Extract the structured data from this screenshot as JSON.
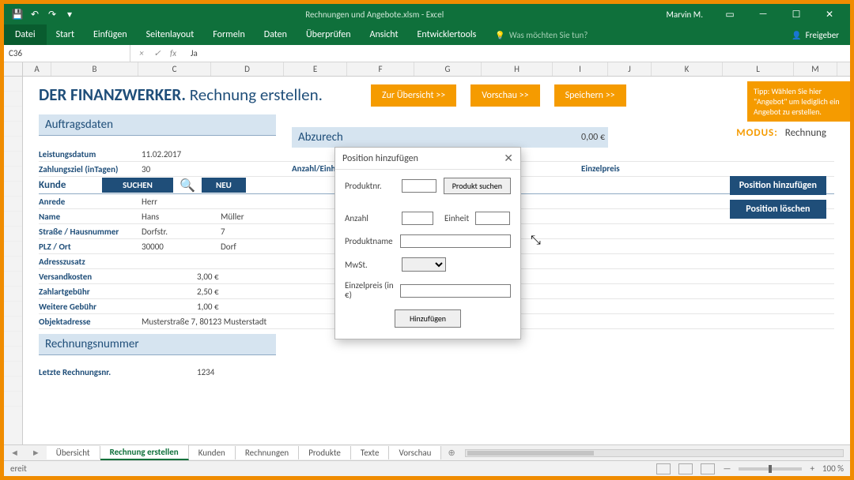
{
  "titlebar": {
    "filename": "Rechnungen und Angebote.xlsm  -  Excel",
    "username": "Marvin M."
  },
  "ribbon": {
    "file": "Datei",
    "tabs": [
      "Start",
      "Einfügen",
      "Seitenlayout",
      "Formeln",
      "Daten",
      "Überprüfen",
      "Ansicht",
      "Entwicklertools"
    ],
    "tellme": "Was möchten Sie tun?",
    "share": "Freigeber"
  },
  "formula": {
    "namebox": "C36",
    "value": "Ja"
  },
  "columns": [
    "A",
    "B",
    "C",
    "D",
    "E",
    "F",
    "G",
    "H",
    "I",
    "J",
    "K",
    "L",
    "M"
  ],
  "page": {
    "title_brand": "DER FINANZWERKER.",
    "title_sub": "Rechnung erstellen.",
    "btn_overview": "Zur Übersicht >>",
    "btn_preview": "Vorschau >>",
    "btn_save": "Speichern >>",
    "hint": "Tipp: Wählen Sie hier \"Angebot\" um lediglich ein Angebot zu erstellen.",
    "modus_label": "MODUS:",
    "modus_value": "Rechnung"
  },
  "sections": {
    "auftragsdaten": "Auftragsdaten",
    "abzurechnen": "Abzurech",
    "rechnungsnr": "Rechnungsnummer"
  },
  "fields": {
    "leistungsdatum_l": "Leistungsdatum",
    "leistungsdatum_v": "11.02.2017",
    "zahlungsziel_l": "Zahlungsziel (inTagen)",
    "zahlungsziel_v": "30",
    "kunde_l": "Kunde",
    "suchen": "SUCHEN",
    "neu": "NEU",
    "anrede_l": "Anrede",
    "anrede_v": "Herr",
    "name_l": "Name",
    "name_v1": "Hans",
    "name_v2": "Müller",
    "strasse_l": "Straße / Hausnummer",
    "strasse_v1": "Dorfstr.",
    "strasse_v2": "7",
    "plz_l": "PLZ / Ort",
    "plz_v1": "30000",
    "plz_v2": "Dorf",
    "adresszusatz_l": "Adresszusatz",
    "versand_l": "Versandkosten",
    "versand_v": "3,00 €",
    "zahlart_l": "Zahlartgebühr",
    "zahlart_v": "2,50 €",
    "weitere_l": "Weitere Gebühr",
    "weitere_v": "1,00 €",
    "objekt_l": "Objektadresse",
    "objekt_v": "Musterstraße 7, 80123 Musterstadt",
    "letzte_l": "Letzte Rechnungsnr.",
    "letzte_v": "1234"
  },
  "billing": {
    "col_anzahl": "Anzahl/Einhe",
    "col_einzelpreis": "Einzelpreis",
    "total": "0,00 €",
    "btn_add": "Position hinzufügen",
    "btn_del": "Position löschen"
  },
  "dialog": {
    "title": "Position hinzufügen",
    "produktnr_l": "Produktnr.",
    "produkt_suchen": "Produkt suchen",
    "anzahl_l": "Anzahl",
    "einheit_l": "Einheit",
    "produktname_l": "Produktname",
    "mwst_l": "MwSt.",
    "einzelpreis_l": "Einzelpreis (in €)",
    "hinzufuegen": "Hinzufügen"
  },
  "sheettabs": [
    "Übersicht",
    "Rechnung erstellen",
    "Kunden",
    "Rechnungen",
    "Produkte",
    "Texte",
    "Vorschau"
  ],
  "status": {
    "ready": "ereit",
    "zoom": "100 %"
  }
}
